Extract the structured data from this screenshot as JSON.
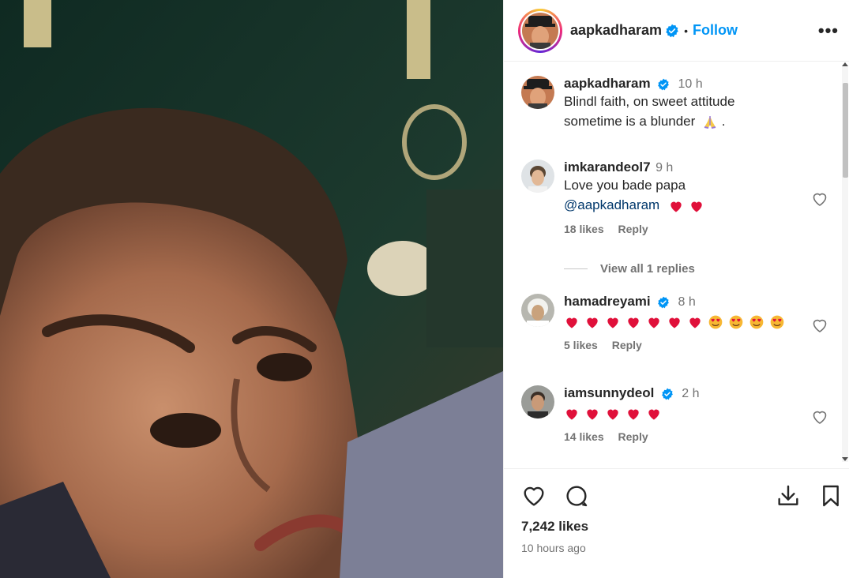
{
  "post": {
    "username": "aapkadharam",
    "follow_label": "Follow",
    "separator": "•",
    "more_label": "•••"
  },
  "caption": {
    "username": "aapkadharam",
    "time": "10 h",
    "text_line1": "Blindl faith, on sweet attitude",
    "text_line2": "sometime is a blunder",
    "text_suffix": " ."
  },
  "comments": [
    {
      "username": "imkarandeol7",
      "time": "9 h",
      "text": "Love you bade papa",
      "mention": "@aapkadharam",
      "likes": "18 likes",
      "reply": "Reply"
    },
    {
      "username": "hamadreyami",
      "time": "8 h",
      "likes": "5 likes",
      "reply": "Reply"
    },
    {
      "username": "iamsunnydeol",
      "time": "2 h",
      "likes": "14 likes",
      "reply": "Reply"
    }
  ],
  "view_replies": "View all 1 replies",
  "footer": {
    "likes": "7,242 likes",
    "time_ago": "10 hours ago"
  },
  "icons": {
    "heart": "heart-icon",
    "comment": "comment-icon",
    "download": "download-icon",
    "bookmark": "bookmark-icon",
    "verified": "verified-badge-icon",
    "emoji_pray": "folded-hands-emoji",
    "emoji_red_heart": "red-heart-emoji",
    "emoji_heart_eyes": "heart-eyes-emoji"
  },
  "colors": {
    "link_blue": "#0095f6",
    "mention": "#00376b",
    "secondary_text": "#737373",
    "heart_red": "#e0103a"
  }
}
